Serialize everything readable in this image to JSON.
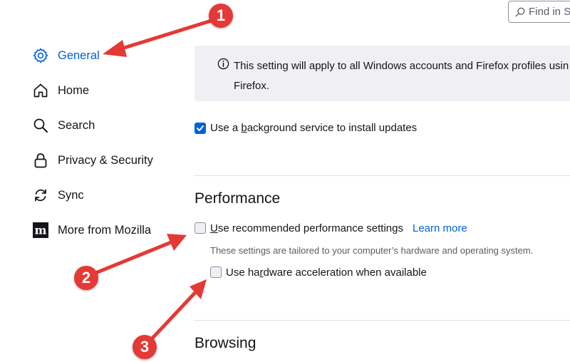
{
  "search": {
    "placeholder": "Find in S",
    "icon": "search-icon"
  },
  "sidebar": {
    "items": [
      {
        "label": "General",
        "icon": "gear-icon",
        "selected": true
      },
      {
        "label": "Home",
        "icon": "home-icon",
        "selected": false
      },
      {
        "label": "Search",
        "icon": "search-icon",
        "selected": false
      },
      {
        "label": "Privacy & Security",
        "icon": "lock-icon",
        "selected": false
      },
      {
        "label": "Sync",
        "icon": "sync-icon",
        "selected": false
      },
      {
        "label": "More from Mozilla",
        "icon": "mozilla-icon",
        "selected": false
      }
    ]
  },
  "updates": {
    "info_line1": "This setting will apply to all Windows accounts and Firefox profiles usin",
    "info_line2": "Firefox.",
    "background_service": {
      "pre": "Use a ",
      "u": "b",
      "post": "ackground service to install updates",
      "checked": true
    }
  },
  "performance": {
    "title": "Performance",
    "recommended": {
      "u": "U",
      "post": "se recommended performance settings",
      "checked": false
    },
    "learn_more": "Learn more",
    "description": "These settings are tailored to your computer’s hardware and operating system.",
    "hardware": {
      "pre": "Use ha",
      "u": "r",
      "post": "dware acceleration when available",
      "checked": false
    }
  },
  "browsing": {
    "title": "Browsing"
  },
  "annotations": {
    "badge1": "1",
    "badge2": "2",
    "badge3": "3",
    "color": "#e53935"
  },
  "colors": {
    "accent": "#0061e0",
    "info_bg": "#f0f0f4"
  }
}
